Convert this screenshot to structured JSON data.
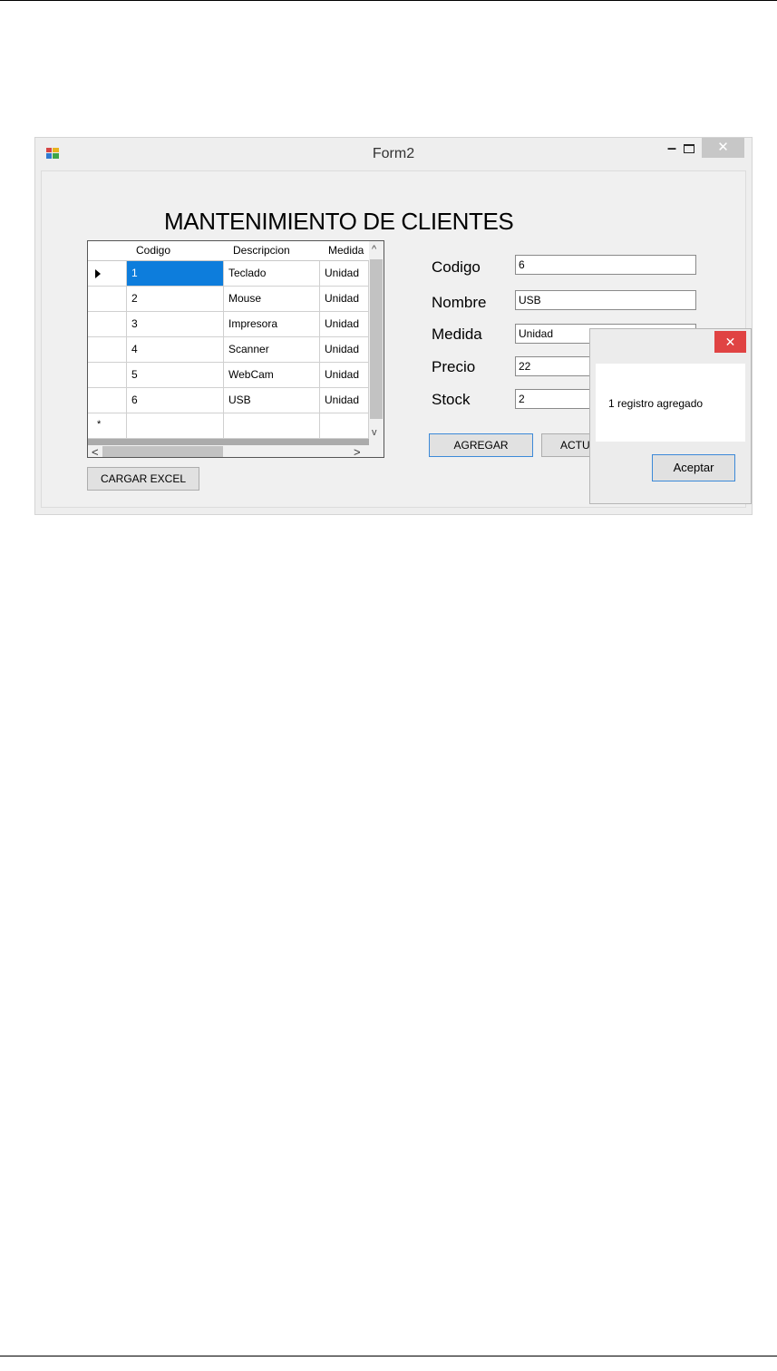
{
  "window": {
    "title": "Form2",
    "minimize_glyph": "–",
    "close_glyph": "✕"
  },
  "form": {
    "heading": "MANTENIMIENTO DE CLIENTES"
  },
  "grid": {
    "columns": [
      "Codigo",
      "Descripcion",
      "Medida"
    ],
    "rows": [
      {
        "codigo": "1",
        "descripcion": "Teclado",
        "medida": "Unidad"
      },
      {
        "codigo": "2",
        "descripcion": "Mouse",
        "medida": "Unidad"
      },
      {
        "codigo": "3",
        "descripcion": "Impresora",
        "medida": "Unidad"
      },
      {
        "codigo": "4",
        "descripcion": "Scanner",
        "medida": "Unidad"
      },
      {
        "codigo": "5",
        "descripcion": "WebCam",
        "medida": "Unidad"
      },
      {
        "codigo": "6",
        "descripcion": "USB",
        "medida": "Unidad"
      }
    ],
    "new_row_marker": "*",
    "scroll_up": "^",
    "scroll_down": "v",
    "scroll_left": "<",
    "scroll_right": ">"
  },
  "fields": {
    "codigo": {
      "label": "Codigo",
      "value": "6"
    },
    "nombre": {
      "label": "Nombre",
      "value": "USB"
    },
    "medida": {
      "label": "Medida",
      "value": "Unidad"
    },
    "precio": {
      "label": "Precio",
      "value": "22"
    },
    "stock": {
      "label": "Stock",
      "value": "2"
    }
  },
  "buttons": {
    "cargar_excel": "CARGAR EXCEL",
    "agregar": "AGREGAR",
    "actualizar_partial": "ACTU"
  },
  "message_box": {
    "text": "1 registro agregado",
    "ok_label": "Aceptar",
    "close_glyph": "✕"
  },
  "colors": {
    "selection": "#0d7ddc",
    "msgbox_close": "#e04343"
  }
}
